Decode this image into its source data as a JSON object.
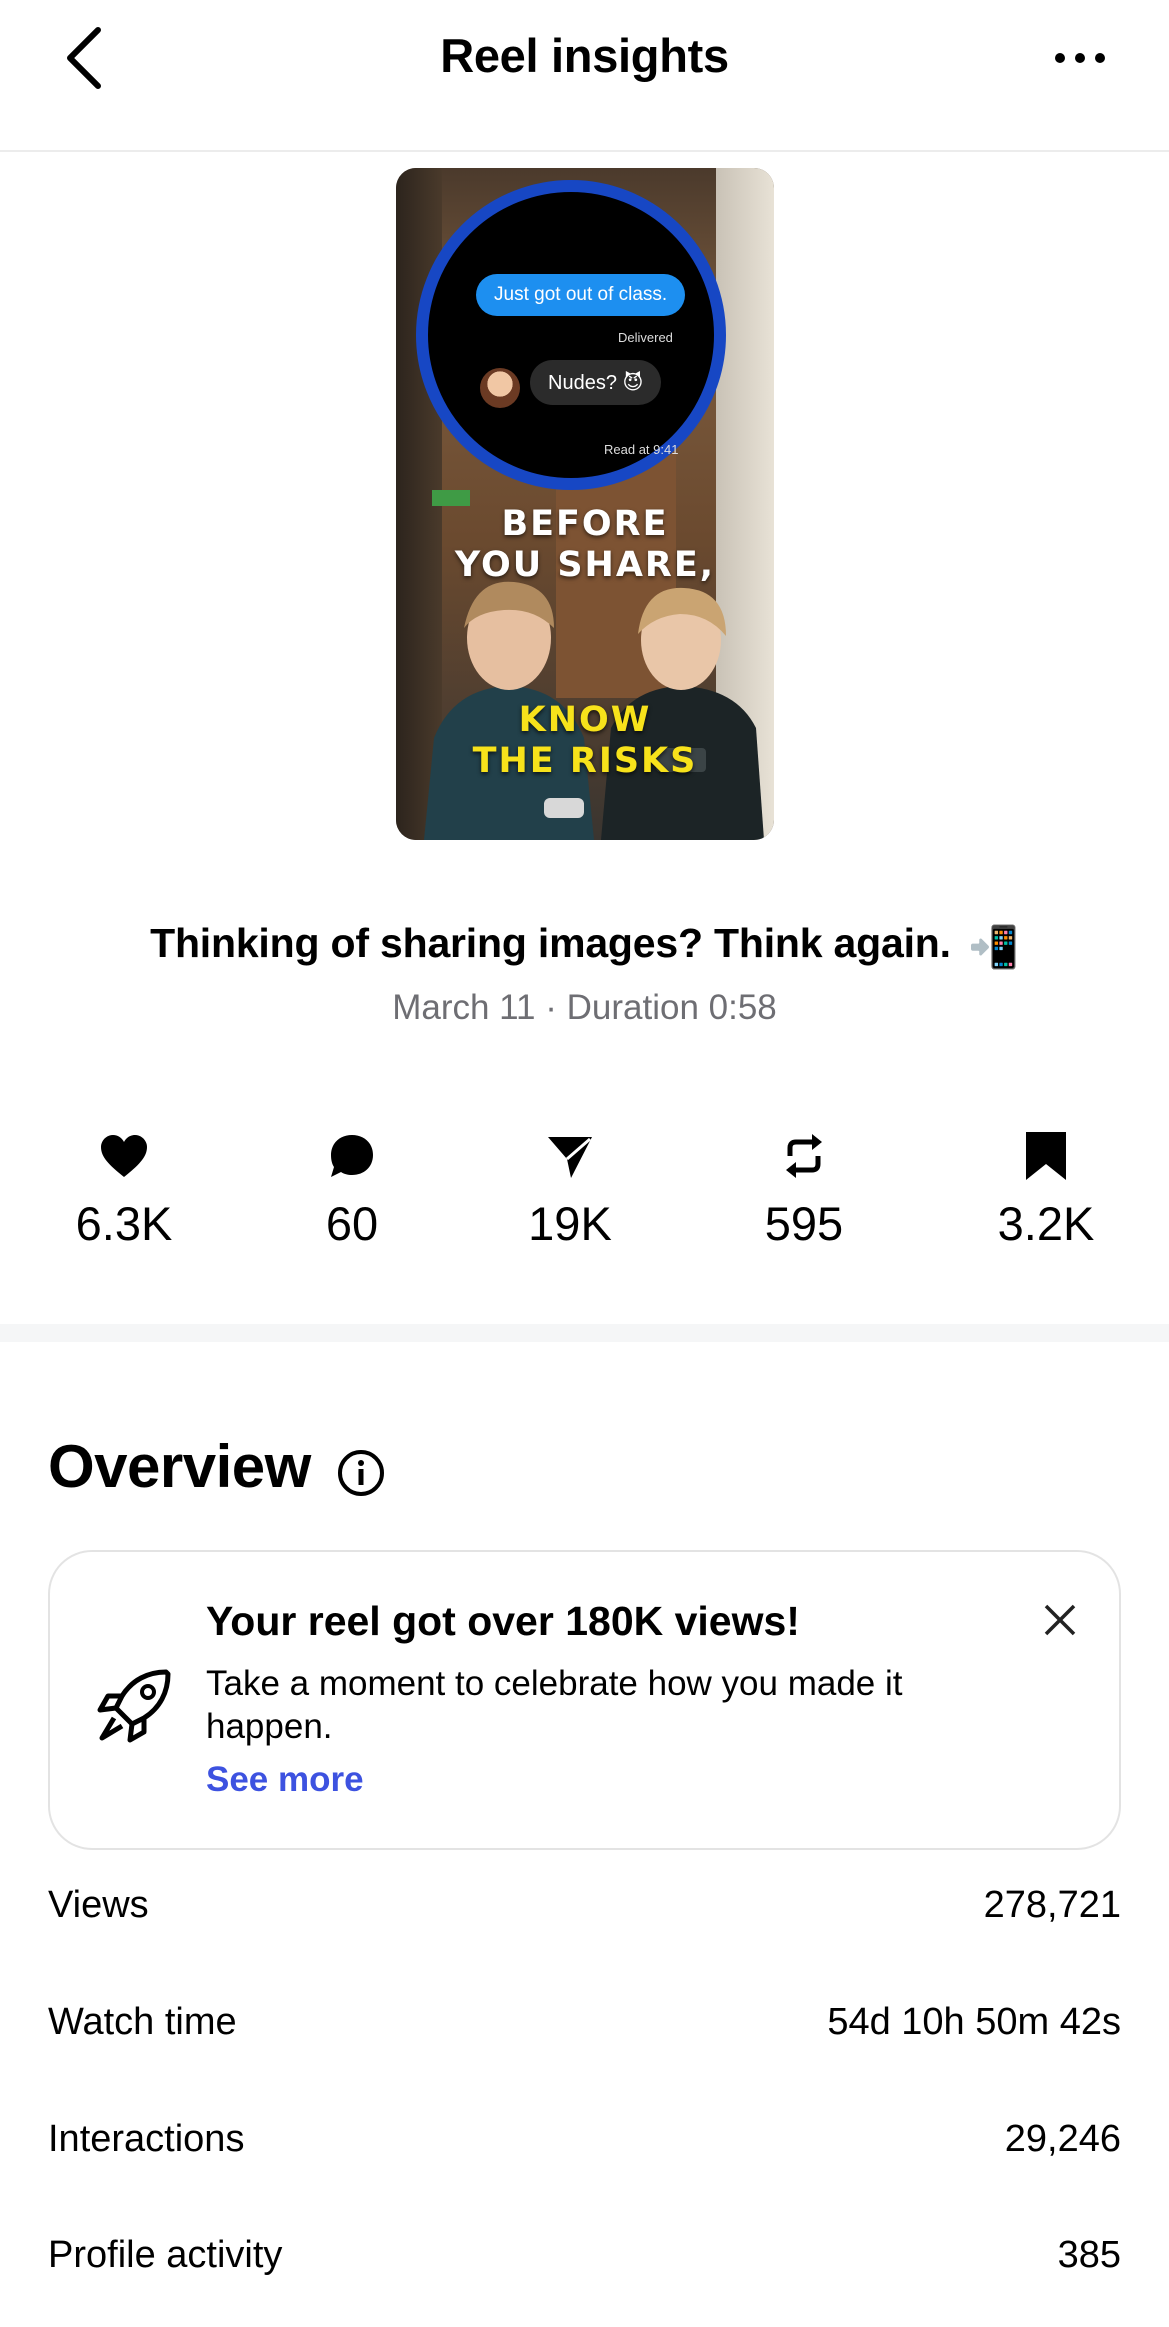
{
  "header": {
    "title": "Reel insights",
    "back_icon": "chevron-left-icon",
    "more_icon": "more-horizontal-icon"
  },
  "thumbnail": {
    "message_sent": "Just got out of class.",
    "delivered": "Delivered",
    "message_received": "Nudes? 😈",
    "read_at": "Read at 9:41",
    "overlay_line1": "BEFORE",
    "overlay_line2": "YOU SHARE,",
    "overlay_line3": "KNOW",
    "overlay_line4": "THE RISKS"
  },
  "reel": {
    "caption": "Thinking of sharing images? Think again.",
    "caption_emoji": "📲",
    "meta": "March 11 · Duration 0:58"
  },
  "stats": [
    {
      "icon": "heart-icon",
      "value": "6.3K"
    },
    {
      "icon": "comment-icon",
      "value": "60"
    },
    {
      "icon": "send-icon",
      "value": "19K"
    },
    {
      "icon": "repost-icon",
      "value": "595"
    },
    {
      "icon": "bookmark-icon",
      "value": "3.2K"
    }
  ],
  "overview": {
    "title": "Overview",
    "info_icon": "info-icon",
    "card": {
      "icon": "rocket-icon",
      "title": "Your reel got over 180K views!",
      "body": "Take a moment to celebrate how you made it happen.",
      "link": "See more",
      "close_icon": "close-icon"
    },
    "metrics": [
      {
        "label": "Views",
        "value": "278,721"
      },
      {
        "label": "Watch time",
        "value": "54d 10h 50m 42s"
      },
      {
        "label": "Interactions",
        "value": "29,246"
      },
      {
        "label": "Profile activity",
        "value": "385"
      }
    ]
  },
  "colors": {
    "link": "#3d52e0",
    "meta_text": "#6e6e73",
    "divider_band": "#f5f6f7",
    "chat_bubble_blue": "#1d8ff0",
    "ring_blue": "#1747c4",
    "overlay_yellow": "#f7e21b"
  }
}
